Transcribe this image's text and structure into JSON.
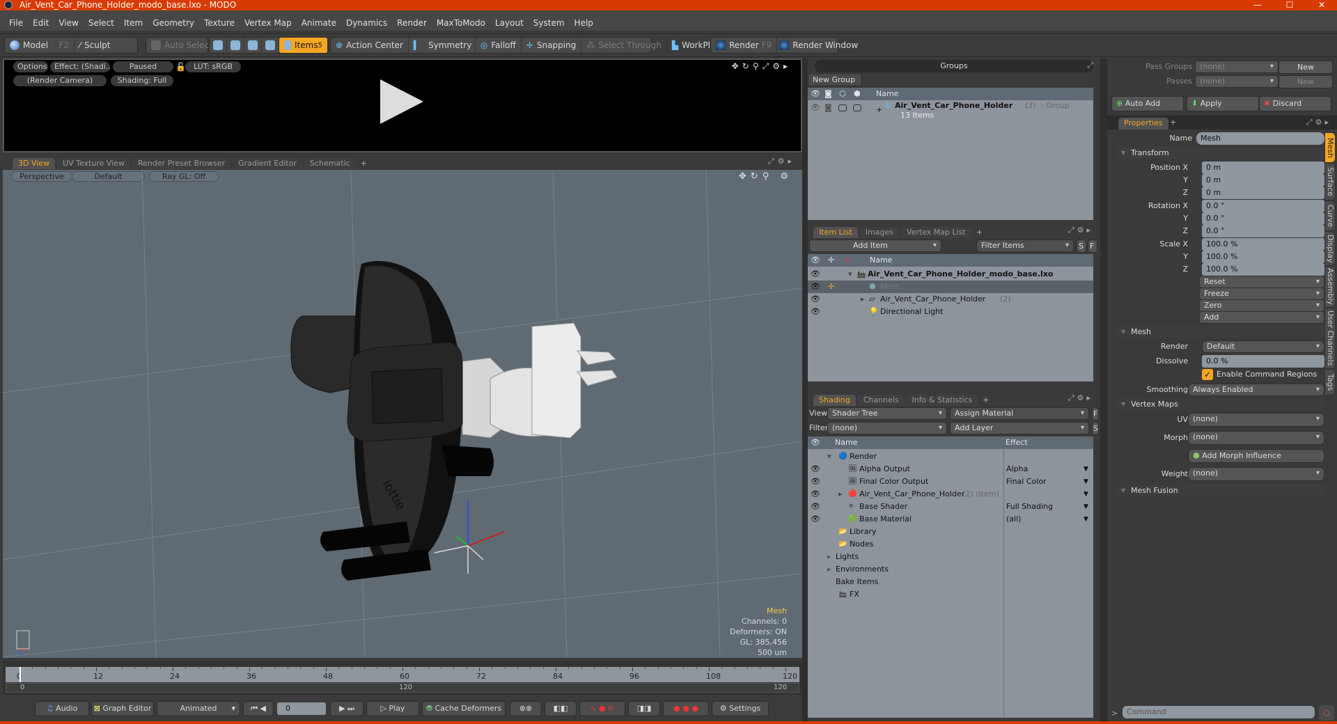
{
  "window": {
    "title": "Air_Vent_Car_Phone_Holder_modo_base.lxo - MODO",
    "controls": [
      "—",
      "☐",
      "✕"
    ]
  },
  "menu": [
    "File",
    "Edit",
    "View",
    "Select",
    "Item",
    "Geometry",
    "Texture",
    "Vertex Map",
    "Animate",
    "Dynamics",
    "Render",
    "MaxToModo",
    "Layout",
    "System",
    "Help"
  ],
  "toolbar": {
    "model": "Model",
    "model_key": "F2",
    "sculpt": "Sculpt",
    "auto_select": "Auto Select",
    "items": "Items",
    "items_key": "5",
    "action_center": "Action Center",
    "symmetry": "Symmetry",
    "falloff": "Falloff",
    "snapping": "Snapping",
    "select_through": "Select Through",
    "workplane": "WorkPlane",
    "render": "Render",
    "render_key": "F9",
    "render_window": "Render Window"
  },
  "render_preview": {
    "options": "Options",
    "effect": "Effect: (Shadi...",
    "paused": "Paused",
    "lut": "LUT: sRGB",
    "camera": "(Render Camera)",
    "shading": "Shading: Full"
  },
  "viewport_tabs": [
    "3D View",
    "UV Texture View",
    "Render Preset Browser",
    "Gradient Editor",
    "Schematic",
    "+"
  ],
  "viewport": {
    "perspective": "Perspective",
    "default": "Default",
    "raygl": "Ray GL: Off",
    "hud": {
      "selection": "Mesh",
      "channels": "Channels: 0",
      "deformers": "Deformers: ON",
      "gl": "GL: 385,456",
      "unit": "500 um"
    },
    "logo_text": "iottie"
  },
  "timeline": {
    "ticks": [
      "0",
      "12",
      "24",
      "36",
      "48",
      "60",
      "72",
      "84",
      "96",
      "108",
      "120"
    ],
    "range_start": "0",
    "range_mid": "120",
    "range_end": "120",
    "audio": "Audio",
    "graph_editor": "Graph Editor",
    "animated": "Animated",
    "frame": "0",
    "play": "Play",
    "cache_deformers": "Cache Deformers",
    "settings": "Settings"
  },
  "groups": {
    "title": "Groups",
    "new_group": "New Group",
    "col_name": "Name",
    "item_name": "Air_Vent_Car_Phone_Holder",
    "item_count": "(3)",
    "item_type": ": Group",
    "item_sub": "13 Items"
  },
  "item_list": {
    "tabs": [
      "Item List",
      "Images",
      "Vertex Map List",
      "+"
    ],
    "add_item": "Add Item",
    "filter_placeholder": "Filter Items",
    "s": "S",
    "f": "F",
    "col_name": "Name",
    "rows": [
      {
        "name": "Air_Vent_Car_Phone_Holder_modo_base.lxo",
        "extra": ""
      },
      {
        "name": "Mesh",
        "extra": ""
      },
      {
        "name": "Air_Vent_Car_Phone_Holder",
        "extra": "(2)"
      },
      {
        "name": "Directional Light",
        "extra": ""
      }
    ]
  },
  "shading": {
    "tabs": [
      "Shading",
      "Channels",
      "Info & Statistics",
      "+"
    ],
    "view_label": "View",
    "view_value": "Shader Tree",
    "assign_material": "Assign Material",
    "filter_label": "Filter",
    "filter_value": "(none)",
    "add_layer": "Add Layer",
    "f": "F",
    "s": "S",
    "col_name": "Name",
    "col_effect": "Effect",
    "rows": [
      {
        "name": "Render",
        "extra": "",
        "effect": ""
      },
      {
        "name": "Alpha Output",
        "extra": "",
        "effect": "Alpha"
      },
      {
        "name": "Final Color Output",
        "extra": "",
        "effect": "Final Color"
      },
      {
        "name": "Air_Vent_Car_Phone_Holder",
        "extra": "(2) (Item)",
        "effect": ""
      },
      {
        "name": "Base Shader",
        "extra": "",
        "effect": "Full Shading"
      },
      {
        "name": "Base Material",
        "extra": "",
        "effect": "(all)"
      },
      {
        "name": "Library",
        "extra": "",
        "effect": ""
      },
      {
        "name": "Nodes",
        "extra": "",
        "effect": ""
      },
      {
        "name": "Lights",
        "extra": "",
        "effect": ""
      },
      {
        "name": "Environments",
        "extra": "",
        "effect": ""
      },
      {
        "name": "Bake Items",
        "extra": "",
        "effect": ""
      },
      {
        "name": "FX",
        "extra": "",
        "effect": ""
      }
    ]
  },
  "passes": {
    "pass_groups_label": "Pass Groups",
    "pass_groups_value": "(none)",
    "passes_label": "Passes",
    "passes_value": "(none)",
    "new": "New",
    "auto_add": "Auto Add",
    "apply": "Apply",
    "discard": "Discard"
  },
  "properties": {
    "tab": "Properties",
    "plus": "+",
    "name_label": "Name",
    "name_value": "Mesh",
    "transform": "Transform",
    "position_label": "Position X",
    "rotation_label": "Rotation X",
    "scale_label": "Scale X",
    "y": "Y",
    "z": "Z",
    "position": [
      "0 m",
      "0 m",
      "0 m"
    ],
    "rotation": [
      "0.0 °",
      "0.0 °",
      "0.0 °"
    ],
    "scale": [
      "100.0 %",
      "100.0 %",
      "100.0 %"
    ],
    "actions": [
      "Reset",
      "Freeze",
      "Zero",
      "Add"
    ],
    "mesh_section": "Mesh",
    "render_label": "Render",
    "render_value": "Default",
    "dissolve_label": "Dissolve",
    "dissolve_value": "0.0 %",
    "enable_cmd_regions": "Enable Command Regions",
    "enable_cmd_regions_checked": true,
    "smoothing_label": "Smoothing",
    "smoothing_value": "Always Enabled",
    "vertex_maps": "Vertex Maps",
    "uv_label": "UV",
    "uv_value": "(none)",
    "morph_label": "Morph",
    "morph_value": "(none)",
    "add_morph": "Add Morph Influence",
    "weight_label": "Weight",
    "weight_value": "(none)",
    "mesh_fusion": "Mesh Fusion",
    "side_tabs": [
      "Mesh",
      "Surface",
      "Curve",
      "Display",
      "Assembly",
      "User Channels",
      "Tags"
    ]
  },
  "command": {
    "prompt": ">",
    "placeholder": "Command"
  },
  "colors": {
    "accent": "#f5a623",
    "titlebar": "#d83b01"
  }
}
